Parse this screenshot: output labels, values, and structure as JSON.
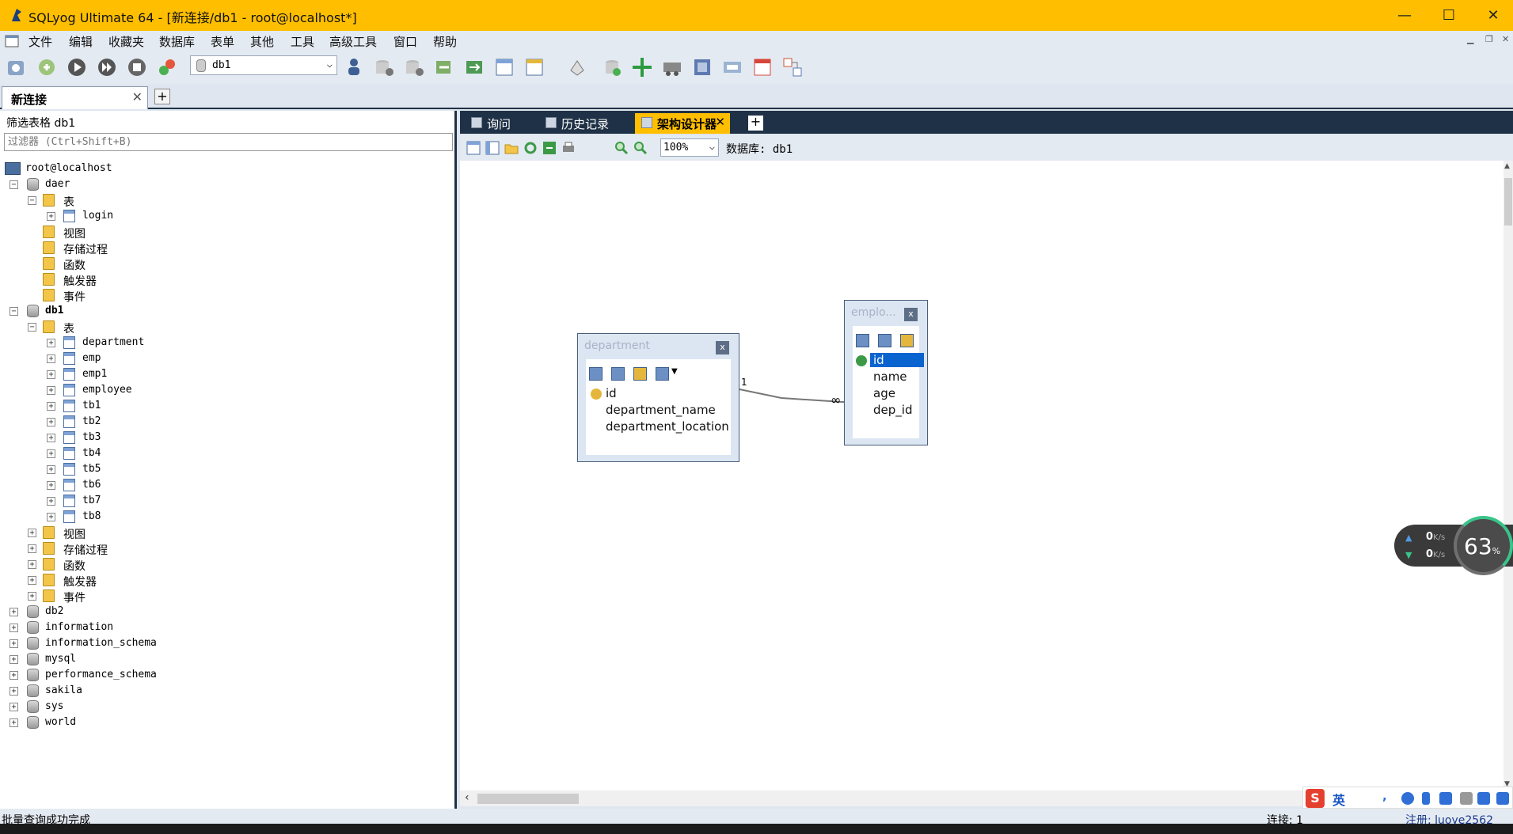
{
  "window": {
    "title": "SQLyog Ultimate 64 - [新连接/db1 - root@localhost*]",
    "minimize": "—",
    "maximize": "☐",
    "close": "✕"
  },
  "menu": [
    "文件",
    "编辑",
    "收藏夹",
    "数据库",
    "表单",
    "其他",
    "工具",
    "高级工具",
    "窗口",
    "帮助"
  ],
  "toolbar": {
    "db_selected": "db1"
  },
  "connection_tab": {
    "label": "新连接",
    "close": "✕",
    "add": "+"
  },
  "object_browser": {
    "filter_label": "筛选表格 db1",
    "filter_placeholder": "过滤器 (Ctrl+Shift+B)",
    "root": "root@localhost",
    "daer": {
      "name": "daer",
      "tables_label": "表",
      "tables": [
        "login"
      ],
      "folders": [
        "视图",
        "存储过程",
        "函数",
        "触发器",
        "事件"
      ]
    },
    "db1": {
      "name": "db1",
      "tables_label": "表",
      "tables": [
        "department",
        "emp",
        "emp1",
        "employee",
        "tb1",
        "tb2",
        "tb3",
        "tb4",
        "tb5",
        "tb6",
        "tb7",
        "tb8"
      ],
      "folders": [
        "视图",
        "存储过程",
        "函数",
        "触发器",
        "事件"
      ]
    },
    "other_dbs": [
      "db2",
      "information",
      "information_schema",
      "mysql",
      "performance_schema",
      "sakila",
      "sys",
      "world"
    ]
  },
  "right_tabs": [
    {
      "label": "询问",
      "active": false
    },
    {
      "label": "历史记录",
      "active": false
    },
    {
      "label": "架构设计器",
      "active": true
    }
  ],
  "schema_designer": {
    "zoom": "100%",
    "db_label": "数据库: db1",
    "tables": [
      {
        "name": "department",
        "columns": [
          "id",
          "department_name",
          "department_location"
        ],
        "pk": "id",
        "selected": null
      },
      {
        "name": "emplo...",
        "columns": [
          "id",
          "name",
          "age",
          "dep_id"
        ],
        "pk": "id",
        "selected": "id"
      }
    ],
    "relation": {
      "from_card": "1",
      "to_card": "∞"
    }
  },
  "net_widget": {
    "up": "0",
    "down": "0",
    "unit": "K/s",
    "percent": "63",
    "percent_sign": "%"
  },
  "statusbar": {
    "message": "批量查询成功完成",
    "connections": "连接: 1",
    "registered": "注册: luoye2562"
  },
  "ime": {
    "lang": "英"
  },
  "colors": {
    "titlebar": "#ffbf00",
    "dark_tabbar": "#1f3146",
    "active_tab": "#ffbf00",
    "selection": "#0a64d0"
  }
}
